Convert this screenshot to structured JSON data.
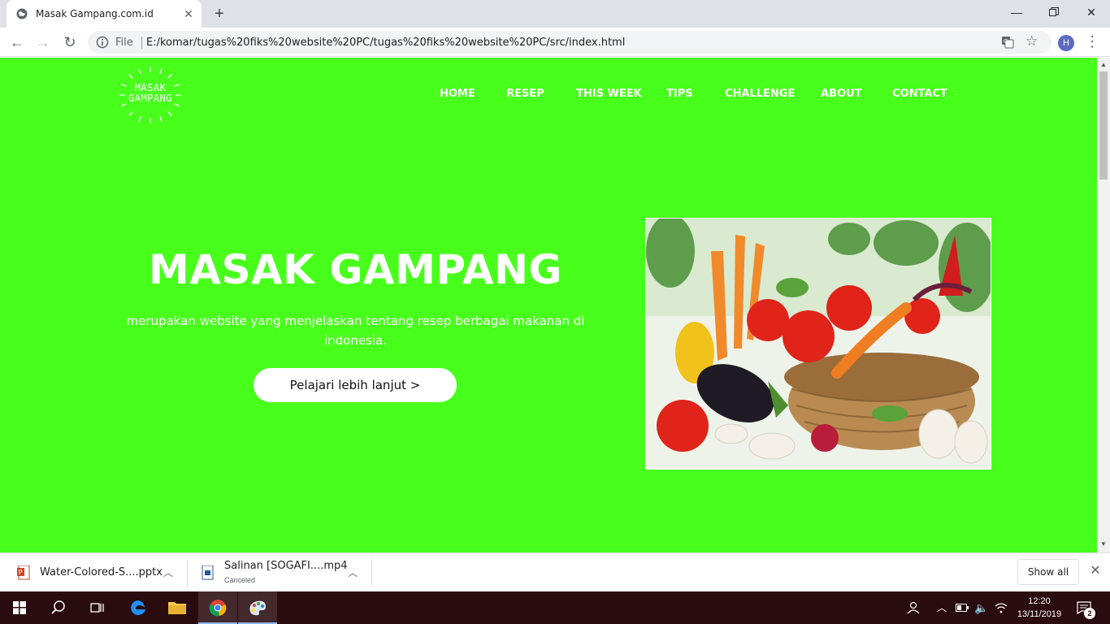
{
  "browser": {
    "tab_title": "Masak Gampang.com.id",
    "file_label": "File",
    "url": "E:/komar/tugas%20fiks%20website%20PC/tugas%20fiks%20website%20PC/src/index.html",
    "avatar_letter": "H"
  },
  "site": {
    "logo_line1": "MASAK",
    "logo_line2": "GAMPANG",
    "nav": [
      "HOME",
      "RESEP",
      "THIS WEEK",
      "TIPS",
      "CHALLENGE",
      "ABOUT",
      "CONTACT"
    ],
    "hero_title": "MASAK GAMPANG",
    "hero_desc_line1": "merupakan website yang menjelaskan tentang resep berbagai makanan di",
    "hero_desc_line2": "indonesia.",
    "hero_button": "Pelajari lebih lanjut >",
    "bg_color": "#48ff1c"
  },
  "downloads": {
    "items": [
      {
        "name": "Water-Colored-S....pptx",
        "status": ""
      },
      {
        "name": "Salinan [SOGAFI....mp4",
        "status": "Canceled"
      }
    ],
    "show_all": "Show all"
  },
  "taskbar": {
    "time": "12:20",
    "date": "13/11/2019",
    "notification_count": "2"
  }
}
